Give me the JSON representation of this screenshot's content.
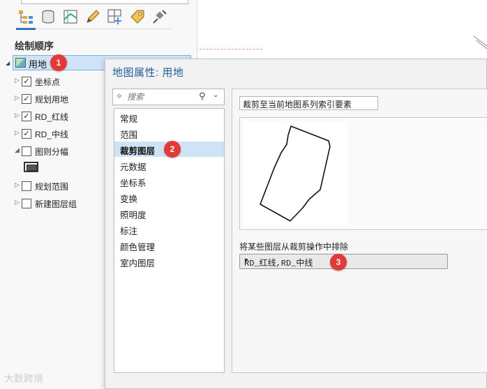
{
  "contents_pane": {
    "toolbar_icons": [
      "list-by-drawing-order-icon",
      "list-by-source-icon",
      "list-by-selection-icon",
      "list-by-editing-icon",
      "list-by-snapping-icon",
      "list-by-labeling-icon",
      "list-by-perspective-imagery-icon"
    ],
    "heading": "绘制顺序",
    "map_item": {
      "label": "用地",
      "badge": "1"
    },
    "layers": [
      {
        "label": "坐标点",
        "checked": true,
        "expander": "▷"
      },
      {
        "label": "规划用地",
        "checked": true,
        "expander": "▷"
      },
      {
        "label": "RD_红线",
        "checked": true,
        "expander": "▷"
      },
      {
        "label": "RD_中线",
        "checked": true,
        "expander": "▷"
      },
      {
        "label": "图则分幅",
        "checked": false,
        "expander": "◢"
      },
      {
        "label": "规划范围",
        "checked": false,
        "expander": "▷"
      },
      {
        "label": "新建图层组",
        "checked": false,
        "expander": "▷"
      }
    ]
  },
  "dialog": {
    "title": "地图属性: 用地",
    "search_placeholder": "搜索",
    "categories": [
      "常规",
      "范围",
      "裁剪图层",
      "元数据",
      "坐标系",
      "变换",
      "照明度",
      "标注",
      "颜色管理",
      "室内图层"
    ],
    "selected_category": "裁剪图层",
    "selected_badge": "2",
    "clip_mode": "裁剪至当前地图系列索引要素",
    "exclude_label": "将某些图层从裁剪操作中排除",
    "exclude_value": "RD_红线,RD_中线",
    "exclude_badge": "3"
  },
  "watermark": "大数跨境",
  "colors": {
    "accent": "#1f5e99",
    "selection": "#cfe3f7",
    "badge": "#e53935"
  }
}
